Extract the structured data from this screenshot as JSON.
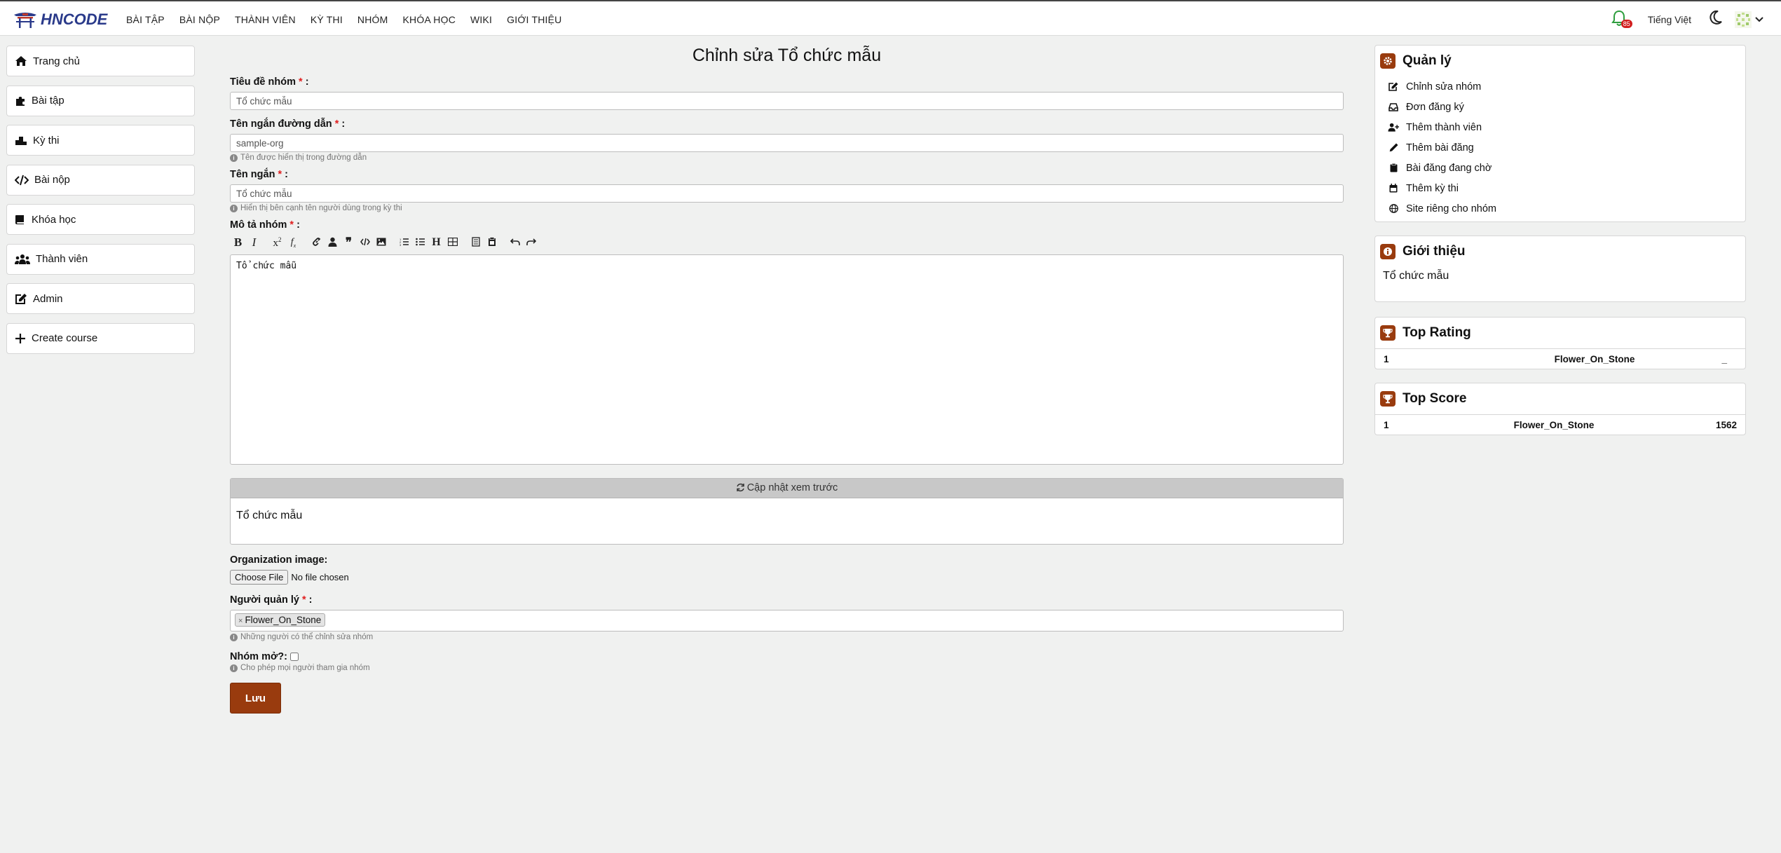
{
  "brand": {
    "logo_text": "HNCODE"
  },
  "nav": {
    "items": [
      "BÀI TẬP",
      "BÀI NỘP",
      "THÀNH VIÊN",
      "KỲ THI",
      "NHÓM",
      "KHÓA HỌC",
      "WIKI",
      "GIỚI THIỆU"
    ],
    "notification_count": "85",
    "language": "Tiếng Việt"
  },
  "sidebar": {
    "items": [
      {
        "label": "Trang chủ",
        "icon": "home-icon"
      },
      {
        "label": "Bài tập",
        "icon": "puzzle-icon"
      },
      {
        "label": "Kỳ thi",
        "icon": "podium-icon"
      },
      {
        "label": "Bài nộp",
        "icon": "code-icon"
      },
      {
        "label": "Khóa học",
        "icon": "book-icon"
      },
      {
        "label": "Thành viên",
        "icon": "users-icon"
      },
      {
        "label": "Admin",
        "icon": "edit-icon"
      },
      {
        "label": "Create course",
        "icon": "plus-icon"
      }
    ]
  },
  "form": {
    "title": "Chỉnh sửa Tổ chức mẫu",
    "name_label": "Tiêu đề nhóm",
    "name_value": "Tổ chức mẫu",
    "slug_label": "Tên ngắn đường dẫn",
    "slug_value": "sample-org",
    "slug_help": "Tên được hiển thị trong đường dẫn",
    "short_label": "Tên ngắn",
    "short_value": "Tổ chức mẫu",
    "short_help": "Hiển thị bên cạnh tên người dùng trong kỳ thi",
    "desc_label": "Mô tả nhóm",
    "desc_value": "Tổ chức mẫu",
    "preview_button": "Cập nhật xem trước",
    "preview_text": "Tổ chức mẫu",
    "image_label": "Organization image:",
    "file_button": "Choose File",
    "file_status": "No file chosen",
    "admins_label": "Người quản lý",
    "admins_value": "Flower_On_Stone",
    "admins_help": "Những người có thể chỉnh sửa nhóm",
    "open_label": "Nhóm mở?:",
    "open_help": "Cho phép mọi người tham gia nhóm",
    "save_button": "Lưu"
  },
  "manage": {
    "title": "Quản lý",
    "items": [
      "Chỉnh sửa nhóm",
      "Đơn đăng ký",
      "Thêm thành viên",
      "Thêm bài đăng",
      "Bài đăng đang chờ",
      "Thêm kỳ thi",
      "Site riêng cho nhóm"
    ]
  },
  "about": {
    "title": "Giới thiệu",
    "text": "Tổ chức mẫu"
  },
  "top_rating": {
    "title": "Top Rating",
    "rank": "1",
    "user": "Flower_On_Stone",
    "value": "_"
  },
  "top_score": {
    "title": "Top Score",
    "rank": "1",
    "user": "Flower_On_Stone",
    "value": "1562"
  },
  "colors": {
    "accent": "#993b0e",
    "required": "#e02020",
    "badge": "#d21f1f"
  }
}
